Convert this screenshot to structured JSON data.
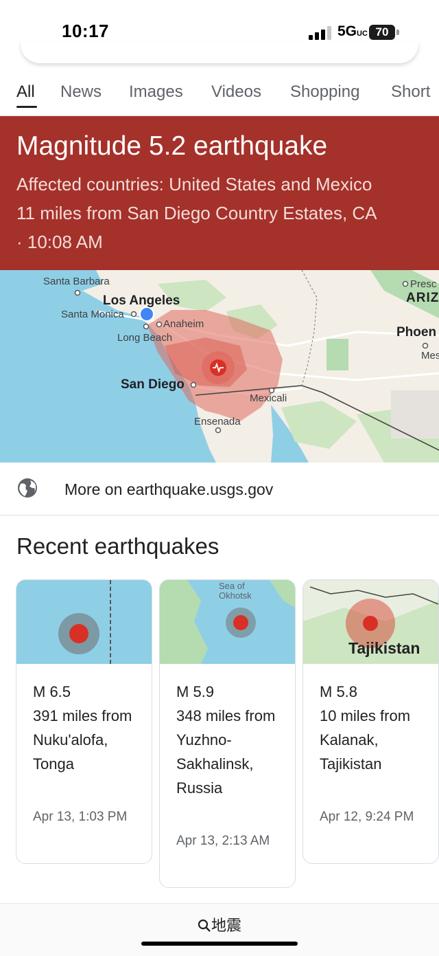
{
  "status_bar": {
    "time": "10:17",
    "network": "5G",
    "network_suffix": "UC",
    "battery": "70"
  },
  "tabs": [
    {
      "label": "All",
      "active": true
    },
    {
      "label": "News"
    },
    {
      "label": "Images"
    },
    {
      "label": "Videos"
    },
    {
      "label": "Shopping"
    },
    {
      "label": "Short"
    }
  ],
  "banner": {
    "title": "Magnitude 5.2 earthquake",
    "affected": "Affected countries: United States and Mexico",
    "location": "11 miles from San Diego Country Estates, CA",
    "time": "· 10:08 AM",
    "color": "#a4312a"
  },
  "map": {
    "labels": {
      "santa_barbara": "Santa Barbara",
      "los_angeles": "Los Angeles",
      "santa_monica": "Santa Monica",
      "anaheim": "Anaheim",
      "long_beach": "Long Beach",
      "san_diego": "San Diego",
      "mexicali": "Mexicali",
      "ensenada": "Ensenada",
      "prescott": "Presc",
      "ariz": "ARIZ",
      "phoenix": "Phoen",
      "mes": "Mes"
    }
  },
  "source_link": {
    "icon": "globe-icon",
    "label": "More on earthquake.usgs.gov"
  },
  "recent": {
    "title": "Recent earthquakes",
    "cards": [
      {
        "magnitude": "M 6.5",
        "place": "391 miles from Nuku'alofa, Tonga",
        "time": "Apr 13, 1:03 PM"
      },
      {
        "magnitude": "M 5.9",
        "place": "348 miles from Yuzhno-Sakhalinsk, Russia",
        "time": "Apr 13, 2:13 AM",
        "map_label": "Sea of Okhotsk"
      },
      {
        "magnitude": "M 5.8",
        "place": "10 miles from Kalanak, Tajikistan",
        "time": "Apr 12, 9:24 PM",
        "map_label": "Tajikistan"
      }
    ]
  },
  "bottom_bar": {
    "query": "地震",
    "icon": "search-icon"
  }
}
